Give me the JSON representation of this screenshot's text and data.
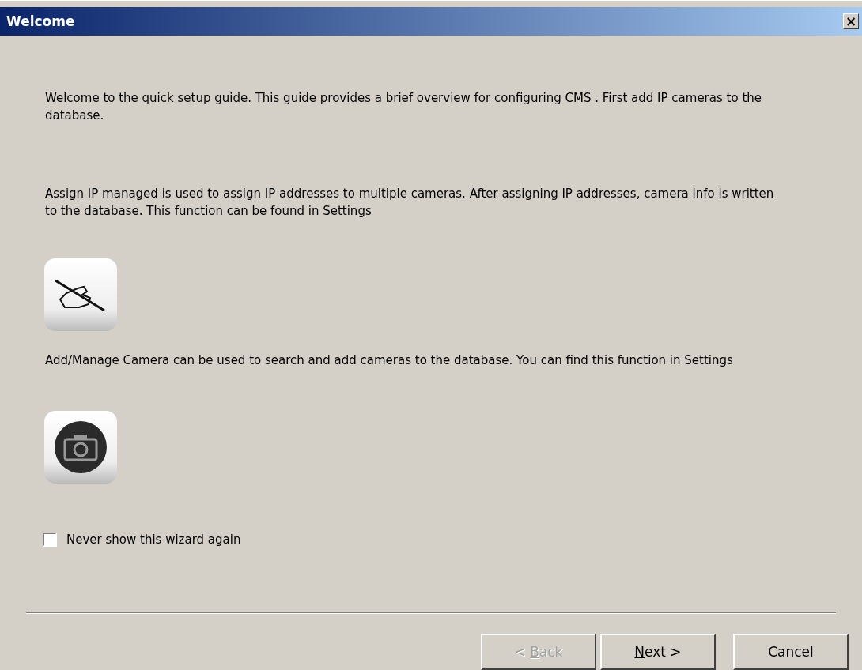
{
  "window": {
    "title": "Welcome",
    "close": "×"
  },
  "paragraphs": [
    {
      "kind": "text",
      "text": "Welcome to the quick setup guide. This guide provides a brief overview for configuring CMS . First add IP cameras to the database."
    },
    {
      "kind": "text",
      "text": "Assign IP managed is used to assign IP addresses to multiple cameras. After assigning IP addresses, camera info is written to the database. This function can be found in Settings"
    },
    {
      "kind": "icon"
    },
    {
      "kind": "text",
      "text": "Add/Manage Camera can be used to search and add cameras to the database. You can find this function in Settings"
    },
    {
      "kind": "icon"
    }
  ],
  "checkbox": {
    "label": "Never show this wizard again",
    "checked": false
  },
  "buttons": [
    {
      "before": "< ",
      "mnemonic": "B",
      "after": "ack",
      "disabled": true
    },
    {
      "mnemonic": "N",
      "after": "ext >",
      "disabled": false
    },
    {
      "before": "Cancel",
      "disabled": false
    }
  ]
}
